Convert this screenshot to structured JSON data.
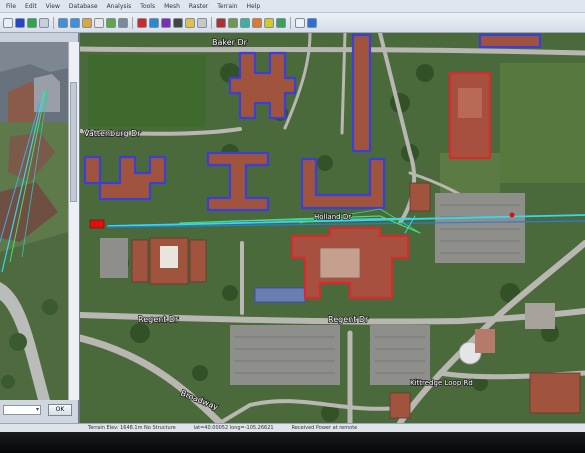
{
  "menu": [
    "File",
    "Edit",
    "View",
    "Database",
    "Analysis",
    "Tools",
    "Mesh",
    "Raster",
    "Terrain",
    "Help"
  ],
  "side_panel": {
    "footer_ok": "OK"
  },
  "map": {
    "streets": {
      "baker": "Baker Dr",
      "vattenburg": "Vattenburg Dr",
      "holland": "Holland Dr",
      "regent_left": "Regent Dr",
      "regent_center": "Regent Dr",
      "broadway": "Broadway",
      "kittredge": "Kittredge Loop Rd"
    }
  },
  "status": {
    "left": "Terrain Elev: 1648.1m  No Structure",
    "coords": "lat=40.00052  long=-105.26621",
    "mode": "Received Power at remote"
  },
  "colors": {
    "building_blue": "#3b3fd6",
    "building_red": "#d72a2a",
    "ray_cyan": "#34d8f2",
    "ray_green": "#43e070",
    "tx_marker": "#e01010"
  }
}
